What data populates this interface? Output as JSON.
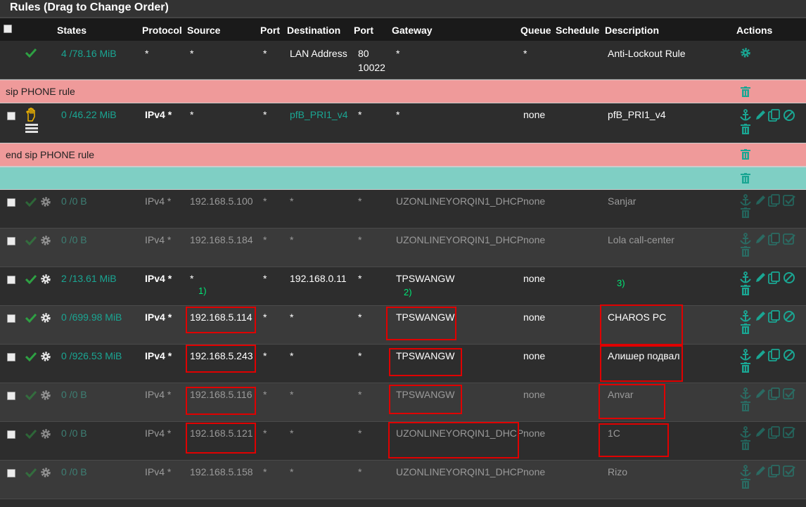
{
  "panel": {
    "title": "Rules (Drag to Change Order)"
  },
  "columns": {
    "states": "States",
    "protocol": "Protocol",
    "source": "Source",
    "port": "Port",
    "destination": "Destination",
    "port2": "Port",
    "gateway": "Gateway",
    "queue": "Queue",
    "schedule": "Schedule",
    "description": "Description",
    "actions": "Actions"
  },
  "antilockout": {
    "states": "4 /78.16 MiB",
    "protocol": "*",
    "source": "*",
    "port": "*",
    "destination": "LAN Address",
    "dport_1": "80",
    "dport_2": "10022",
    "gateway": "*",
    "queue": "*",
    "description": "Anti-Lockout Rule"
  },
  "separators": {
    "sip_start": "sip PHONE rule",
    "sip_end": "end sip PHONE rule",
    "teal": ""
  },
  "pfb_rule": {
    "states": "0 /46.22 MiB",
    "protocol": "IPv4 *",
    "source": "*",
    "port": "*",
    "destination": "pfB_PRI1_v4",
    "dport": "*",
    "gateway": "*",
    "queue": "none",
    "description": "pfB_PRI1_v4"
  },
  "rules": [
    {
      "states": "0 /0 B",
      "protocol": "IPv4 *",
      "source": "192.168.5.100",
      "port": "*",
      "destination": "*",
      "dport": "*",
      "gateway": "UZONLINEYORQIN1_DHCP",
      "queue": "none",
      "description": "Sanjar",
      "disabled": true
    },
    {
      "states": "0 /0 B",
      "protocol": "IPv4 *",
      "source": "192.168.5.184",
      "port": "*",
      "destination": "*",
      "dport": "*",
      "gateway": "UZONLINEYORQIN1_DHCP",
      "queue": "none",
      "description": "Lola call-center",
      "disabled": true
    },
    {
      "states": "2 /13.61 MiB",
      "protocol": "IPv4 *",
      "source": "*",
      "port": "*",
      "destination": "192.168.0.11",
      "dport": "*",
      "gateway": "TPSWANGW",
      "queue": "none",
      "description": "",
      "disabled": false
    },
    {
      "states": "0 /699.98 MiB",
      "protocol": "IPv4 *",
      "source": "192.168.5.114",
      "port": "*",
      "destination": "*",
      "dport": "*",
      "gateway": "TPSWANGW",
      "queue": "none",
      "description": "CHAROS PC",
      "disabled": false
    },
    {
      "states": "0 /926.53 MiB",
      "protocol": "IPv4 *",
      "source": "192.168.5.243",
      "port": "*",
      "destination": "*",
      "dport": "*",
      "gateway": "TPSWANGW",
      "queue": "none",
      "description": "Алишер подвал",
      "disabled": false
    },
    {
      "states": "0 /0 B",
      "protocol": "IPv4 *",
      "source": "192.168.5.116",
      "port": "*",
      "destination": "*",
      "dport": "*",
      "gateway": "TPSWANGW",
      "queue": "none",
      "description": "Anvar",
      "disabled": true
    },
    {
      "states": "0 /0 B",
      "protocol": "IPv4 *",
      "source": "192.168.5.121",
      "port": "*",
      "destination": "*",
      "dport": "*",
      "gateway": "UZONLINEYORQIN1_DHCP",
      "queue": "none",
      "description": "1C",
      "disabled": true
    },
    {
      "states": "0 /0 B",
      "protocol": "IPv4 *",
      "source": "192.168.5.158",
      "port": "*",
      "destination": "*",
      "dport": "*",
      "gateway": "UZONLINEYORQIN1_DHCP",
      "queue": "none",
      "description": "Rizo",
      "disabled": true
    }
  ],
  "annotations": {
    "label_1": "1)",
    "label_2": "2)",
    "label_3": "3)"
  },
  "colors": {
    "accent": "#1aa693",
    "pass": "#2ea043",
    "separator_pink": "#ef9a9a",
    "separator_teal": "#7fcfc4",
    "highlight": "#e00000",
    "annotation_text": "#00e676"
  }
}
